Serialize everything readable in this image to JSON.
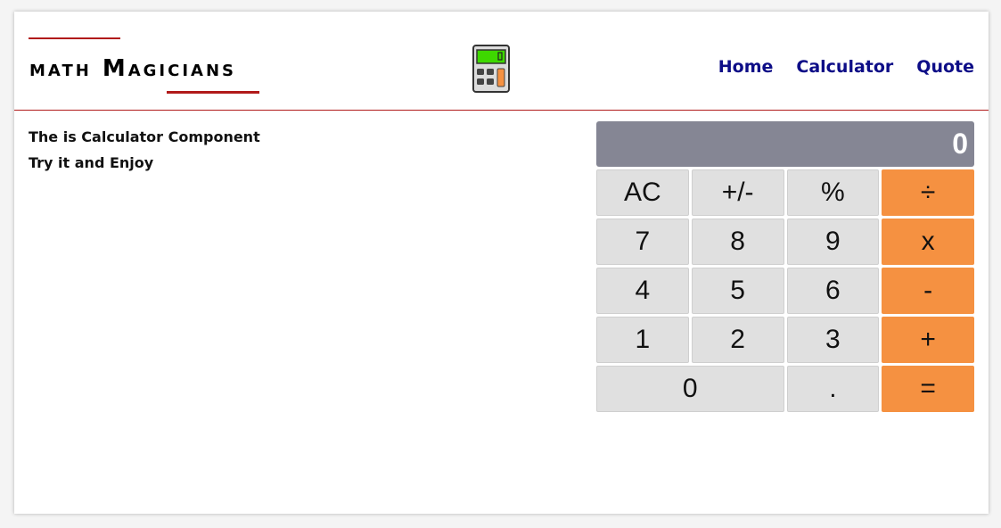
{
  "header": {
    "logo_text": "math Magicians",
    "logo_icon": "calculator-icon",
    "nav": {
      "home": "Home",
      "calculator": "Calculator",
      "quote": "Quote"
    }
  },
  "intro": {
    "line1": "The is Calculator Component",
    "line2": "Try it and Enjoy"
  },
  "calculator": {
    "display": "0",
    "keys": {
      "ac": "AC",
      "sign": "+/-",
      "percent": "%",
      "divide": "÷",
      "seven": "7",
      "eight": "8",
      "nine": "9",
      "multiply": "x",
      "four": "4",
      "five": "5",
      "six": "6",
      "minus": "-",
      "one": "1",
      "two": "2",
      "three": "3",
      "plus": "+",
      "zero": "0",
      "dot": ".",
      "equals": "="
    }
  },
  "colors": {
    "accent_red": "#b11a1a",
    "nav_blue": "#0d0d87",
    "display_gray": "#858694",
    "operator_orange": "#f59141",
    "key_gray": "#e0e0e0"
  }
}
